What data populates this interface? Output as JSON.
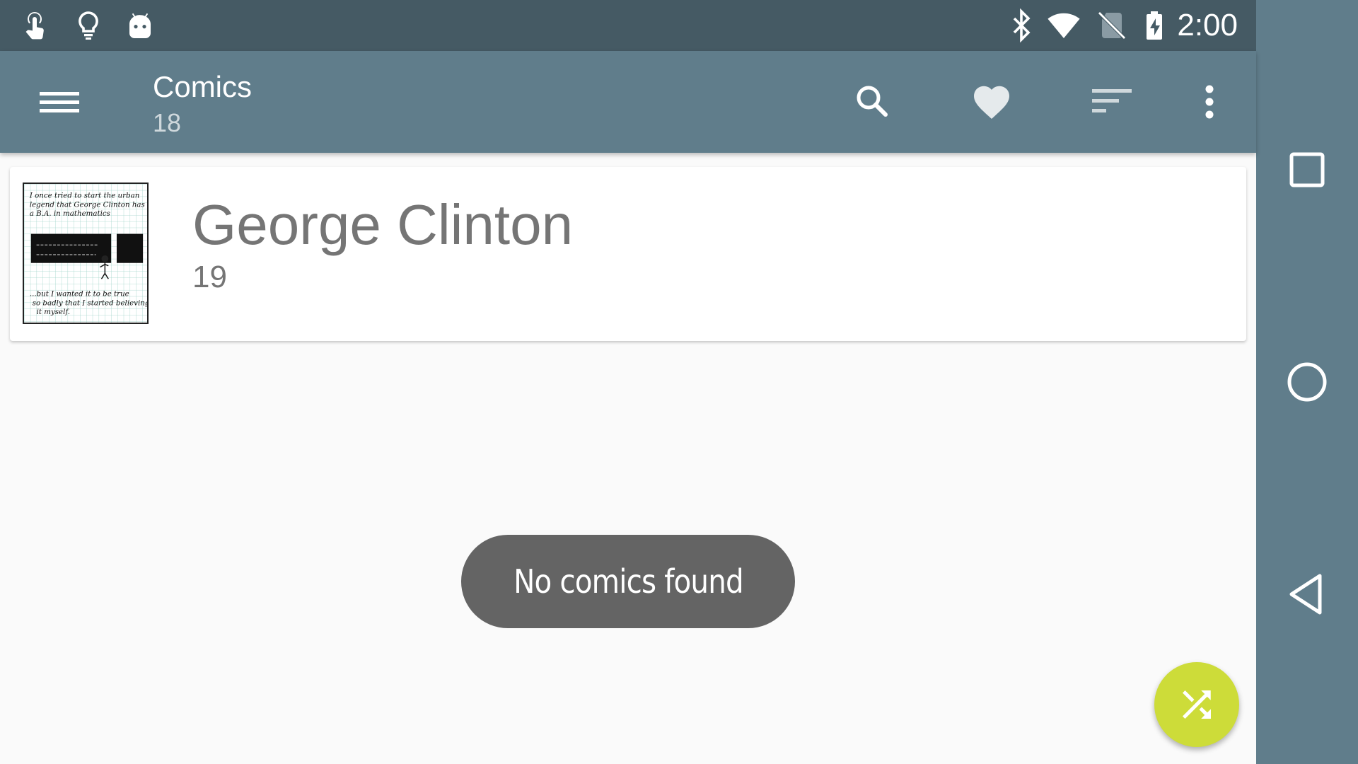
{
  "status_bar": {
    "time": "2:00",
    "left_icons": [
      "touch-app-icon",
      "lightbulb-icon",
      "android-debug-icon"
    ],
    "right_icons": [
      "bluetooth-icon",
      "wifi-icon",
      "no-sim-icon",
      "battery-charging-icon"
    ]
  },
  "toolbar": {
    "title": "Comics",
    "subtitle": "18",
    "menu_icon": "hamburger-menu-icon",
    "actions": [
      "search-icon",
      "favorite-heart-icon",
      "sort-icon",
      "more-vert-icon"
    ]
  },
  "list": {
    "items": [
      {
        "title": "George Clinton",
        "number": "19",
        "thumbnail": {
          "top_text": "I once tried to start the urban legend that George Clinton has a B.A. in mathematics",
          "bottom_text": "...but I wanted it to be true so badly that I started believing it myself."
        }
      }
    ]
  },
  "toast": {
    "message": "No comics found"
  },
  "fab": {
    "icon": "shuffle-icon",
    "color": "#cddc39"
  },
  "nav_bar": {
    "buttons": [
      "recents-square-icon",
      "home-circle-icon",
      "back-triangle-icon"
    ]
  },
  "colors": {
    "status_bar": "#455a64",
    "toolbar": "#607d8b",
    "nav_bar": "#607d8b",
    "background": "#fafafa",
    "toast": "#646464",
    "accent": "#cddc39"
  }
}
